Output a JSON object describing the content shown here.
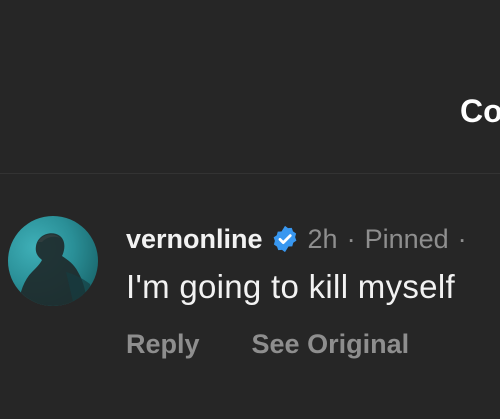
{
  "header": {
    "title": "Co"
  },
  "comment": {
    "username": "vernonline",
    "verified": true,
    "verified_icon": "verified-badge-icon",
    "time": "2h",
    "separator": "·",
    "pinned_label": "Pinned",
    "text": "I'm going to kill myself",
    "actions": {
      "reply_label": "Reply",
      "see_original_label": "See Original"
    }
  },
  "colors": {
    "background": "#262626",
    "primary_text": "#f2f2f2",
    "secondary_text": "#8e8e8e",
    "verified_blue": "#3897f0",
    "avatar_teal": "#2a8f97"
  }
}
